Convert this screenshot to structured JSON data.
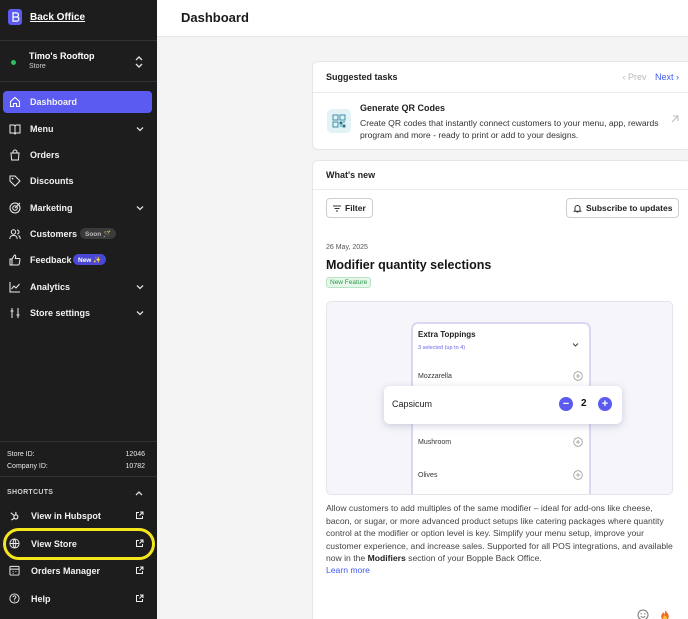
{
  "app": {
    "brand": "Back Office"
  },
  "store": {
    "name": "Timo's Rooftop",
    "type": "Store",
    "status_color": "#2bbf5c"
  },
  "nav": {
    "items": [
      {
        "label": "Dashboard",
        "icon": "home-icon",
        "active": true
      },
      {
        "label": "Menu",
        "icon": "book-icon",
        "expandable": true
      },
      {
        "label": "Orders",
        "icon": "bag-icon"
      },
      {
        "label": "Discounts",
        "icon": "tag-icon"
      },
      {
        "label": "Marketing",
        "icon": "target-icon",
        "expandable": true
      },
      {
        "label": "Customers",
        "icon": "users-icon",
        "badge": "Soon 🪄"
      },
      {
        "label": "Feedback",
        "icon": "thumbs-up-icon",
        "badge": "New ✨"
      },
      {
        "label": "Analytics",
        "icon": "chart-icon",
        "expandable": true
      },
      {
        "label": "Store settings",
        "icon": "sliders-icon",
        "expandable": true
      }
    ]
  },
  "ids": {
    "store_label": "Store ID:",
    "store_value": "12046",
    "company_label": "Company ID:",
    "company_value": "10782"
  },
  "shortcuts": {
    "heading": "SHORTCUTS",
    "items": [
      {
        "label": "View in Hubspot",
        "icon": "hubspot-icon"
      },
      {
        "label": "View Store",
        "icon": "globe-icon",
        "highlighted": true
      },
      {
        "label": "Orders Manager",
        "icon": "calendar-icon"
      },
      {
        "label": "Help",
        "icon": "help-icon"
      }
    ]
  },
  "header": {
    "title": "Dashboard"
  },
  "suggested": {
    "heading": "Suggested tasks",
    "prev": "Prev",
    "next": "Next",
    "task_title": "Generate QR Codes",
    "task_desc": "Create QR codes that instantly connect customers to your menu, app, rewards program and more - ready to print or add to your designs."
  },
  "news": {
    "heading": "What's new",
    "filter_label": "Filter",
    "subscribe_label": "Subscribe to updates",
    "date": "26 May, 2025",
    "title": "Modifier quantity selections",
    "tag": "New Feature",
    "preview": {
      "group": "Extra Toppings",
      "group_sub": "3 selected (up to 4)",
      "rows": [
        "Mozzarella",
        "Mushroom",
        "Olives"
      ],
      "selected": "Capsicum",
      "qty": "2"
    },
    "body_1": "Allow customers to add multiples of the same modifier – ideal for add-ons like cheese, bacon, or sugar, or more advanced product setups like catering packages where quantity control at the modifier or option level is key. Simplify your menu setup, improve your customer experience, and increase sales. Supported for all POS integrations, and available now in the ",
    "body_bold": "Modifiers",
    "body_2": " section of your Bopple Back Office.",
    "learn_more": "Learn more"
  },
  "colors": {
    "accent": "#5b5bf2",
    "link": "#3f5cf0",
    "highlight": "#f5e61c",
    "sidebar": "#1d1d1d"
  }
}
